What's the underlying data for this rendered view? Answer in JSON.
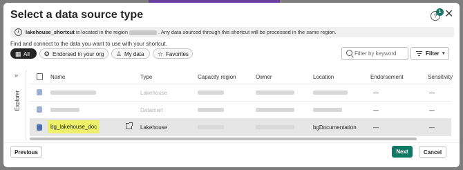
{
  "dialog": {
    "title": "Select a data source type",
    "notification_count": "1",
    "help_icon": "question-circle-icon",
    "close_icon": "close-icon"
  },
  "banner": {
    "shortcut_name": "lakehouse_shortcut",
    "text_before_region": "is located in the region",
    "text_after_region": ". Any data sourced through this shortcut will be processed in the same region."
  },
  "find_text": "Find and connect to the data you want to use with your shortcut.",
  "chips": [
    {
      "label": "All",
      "icon": "grid-icon",
      "active": true
    },
    {
      "label": "Endorsed in your org",
      "icon": "ribbon-icon",
      "active": false
    },
    {
      "label": "My data",
      "icon": "person-icon",
      "active": false
    },
    {
      "label": "Favorites",
      "icon": "star-icon",
      "active": false
    }
  ],
  "search": {
    "placeholder": "Filter by keyword"
  },
  "filter": {
    "label": "Filter"
  },
  "explorer": {
    "label": "Explorer"
  },
  "table": {
    "columns": [
      "Name",
      "Type",
      "Capacity region",
      "Owner",
      "Location",
      "Endorsement",
      "Sensitivity"
    ],
    "rows": [
      {
        "type": "Lakehouse",
        "endorsement": "—",
        "sensitivity": "—"
      },
      {
        "type": "Datamart",
        "endorsement": "—",
        "sensitivity": "—"
      },
      {
        "name": "bg_lakehouse_doc",
        "type": "Lakehouse",
        "location": "bgDocumentation",
        "endorsement": "—",
        "sensitivity": "—"
      }
    ]
  },
  "footer": {
    "previous": "Previous",
    "next": "Next",
    "cancel": "Cancel"
  },
  "colors": {
    "primary": "#117865",
    "highlight": "#eef06a",
    "selected_row": "#e6e6e6"
  }
}
